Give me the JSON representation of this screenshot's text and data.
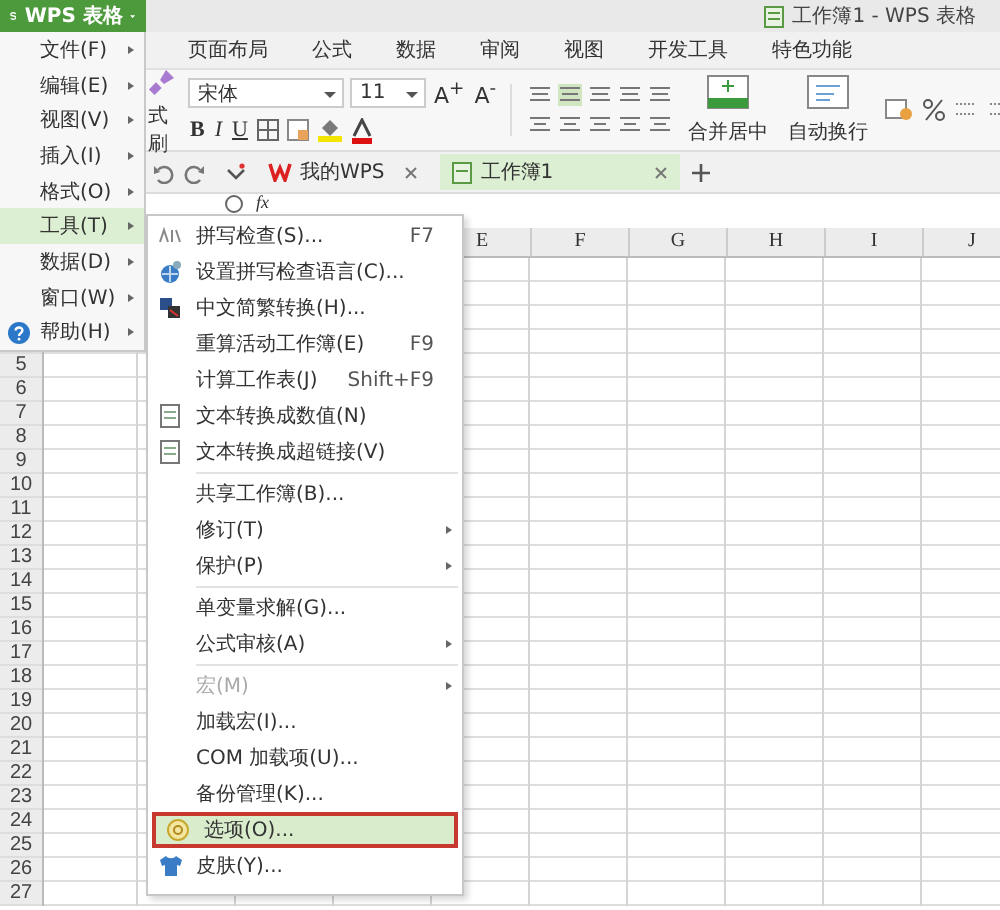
{
  "window": {
    "title": "工作簿1 - WPS 表格"
  },
  "app_button": {
    "label": "WPS 表格"
  },
  "ribbon": {
    "tabs": [
      {
        "label": "页面布局",
        "selected": false
      },
      {
        "label": "公式",
        "selected": false
      },
      {
        "label": "数据",
        "selected": false
      },
      {
        "label": "审阅",
        "selected": false
      },
      {
        "label": "视图",
        "selected": false
      },
      {
        "label": "开发工具",
        "selected": false
      },
      {
        "label": "特色功能",
        "selected": false
      }
    ],
    "format_painter": "式刷",
    "font_name": "宋体",
    "font_size": "11",
    "size_buttons": [
      "A$^{+}$",
      "A$^{-}$"
    ],
    "style_buttons": [
      "B",
      "I",
      "U"
    ],
    "merge_button": "合并居中",
    "wrap_button": "自动换行"
  },
  "doc_tabs": [
    {
      "label": "我的WPS",
      "selected": false
    },
    {
      "label": "工作簿1",
      "selected": true
    }
  ],
  "formula_bar": {
    "function_label": "fx"
  },
  "grid": {
    "columns": [
      "E",
      "F",
      "G",
      "H",
      "I",
      "J"
    ],
    "rows": [
      "5",
      "6",
      "7",
      "8",
      "9",
      "10",
      "11",
      "12",
      "13",
      "14",
      "15",
      "16",
      "17",
      "18",
      "19",
      "20",
      "21",
      "22",
      "23",
      "24",
      "25",
      "26",
      "27"
    ]
  },
  "main_menu": [
    {
      "label": "文件(F)",
      "selected": false,
      "kind": "plain"
    },
    {
      "label": "编辑(E)",
      "selected": false,
      "kind": "plain"
    },
    {
      "label": "视图(V)",
      "selected": false,
      "kind": "plain"
    },
    {
      "label": "插入(I)",
      "selected": false,
      "kind": "plain"
    },
    {
      "label": "格式(O)",
      "selected": false,
      "kind": "plain"
    },
    {
      "label": "工具(T)",
      "selected": true,
      "kind": "plain"
    },
    {
      "label": "数据(D)",
      "selected": false,
      "kind": "plain"
    },
    {
      "label": "窗口(W)",
      "selected": false,
      "kind": "plain"
    },
    {
      "label": "帮助(H)",
      "selected": false,
      "kind": "help"
    }
  ],
  "tools_menu": [
    {
      "kind": "spelling",
      "label": "拼写检查(S)...",
      "shortcut": "F7",
      "submenu": false,
      "disabled": false,
      "selected": false,
      "annotated": false
    },
    {
      "kind": "language",
      "label": "设置拼写检查语言(C)...",
      "submenu": false,
      "disabled": false,
      "selected": false,
      "annotated": false
    },
    {
      "kind": "convert",
      "label": "中文简繁转换(H)...",
      "submenu": false,
      "disabled": false,
      "selected": false,
      "annotated": false
    },
    {
      "kind": "plain",
      "label": "重算活动工作簿(E)",
      "shortcut": "F9",
      "submenu": false,
      "disabled": false,
      "selected": false,
      "annotated": false
    },
    {
      "kind": "plain",
      "label": "计算工作表(J)",
      "shortcut": "Shift+F9",
      "submenu": false,
      "disabled": false,
      "selected": false,
      "annotated": false
    },
    {
      "kind": "document",
      "label": "文本转换成数值(N)",
      "submenu": false,
      "disabled": false,
      "selected": false,
      "annotated": false
    },
    {
      "kind": "document",
      "label": "文本转换成超链接(V)",
      "submenu": false,
      "disabled": false,
      "selected": false,
      "annotated": false
    },
    {
      "kind": "separator"
    },
    {
      "kind": "plain",
      "label": "共享工作簿(B)...",
      "submenu": false,
      "disabled": false,
      "selected": false,
      "annotated": false
    },
    {
      "kind": "plain",
      "label": "修订(T)",
      "submenu": true,
      "disabled": false,
      "selected": false,
      "annotated": false
    },
    {
      "kind": "plain",
      "label": "保护(P)",
      "submenu": true,
      "disabled": false,
      "selected": false,
      "annotated": false
    },
    {
      "kind": "separator"
    },
    {
      "kind": "plain",
      "label": "单变量求解(G)...",
      "submenu": false,
      "disabled": false,
      "selected": false,
      "annotated": false
    },
    {
      "kind": "plain",
      "label": "公式审核(A)",
      "submenu": true,
      "disabled": false,
      "selected": false,
      "annotated": false
    },
    {
      "kind": "separator"
    },
    {
      "kind": "plain",
      "label": "宏(M)",
      "submenu": true,
      "disabled": true,
      "selected": false,
      "annotated": false
    },
    {
      "kind": "plain",
      "label": "加载宏(I)...",
      "submenu": false,
      "disabled": false,
      "selected": false,
      "annotated": false
    },
    {
      "kind": "plain",
      "label": "COM 加载项(U)...",
      "submenu": false,
      "disabled": false,
      "selected": false,
      "annotated": false
    },
    {
      "kind": "plain",
      "label": "备份管理(K)...",
      "submenu": false,
      "disabled": false,
      "selected": false,
      "annotated": false
    },
    {
      "kind": "options",
      "label": "选项(O)...",
      "submenu": false,
      "disabled": false,
      "selected": true,
      "annotated": true
    },
    {
      "kind": "skin",
      "label": "皮肤(Y)...",
      "submenu": false,
      "disabled": false,
      "selected": false,
      "annotated": false
    }
  ]
}
